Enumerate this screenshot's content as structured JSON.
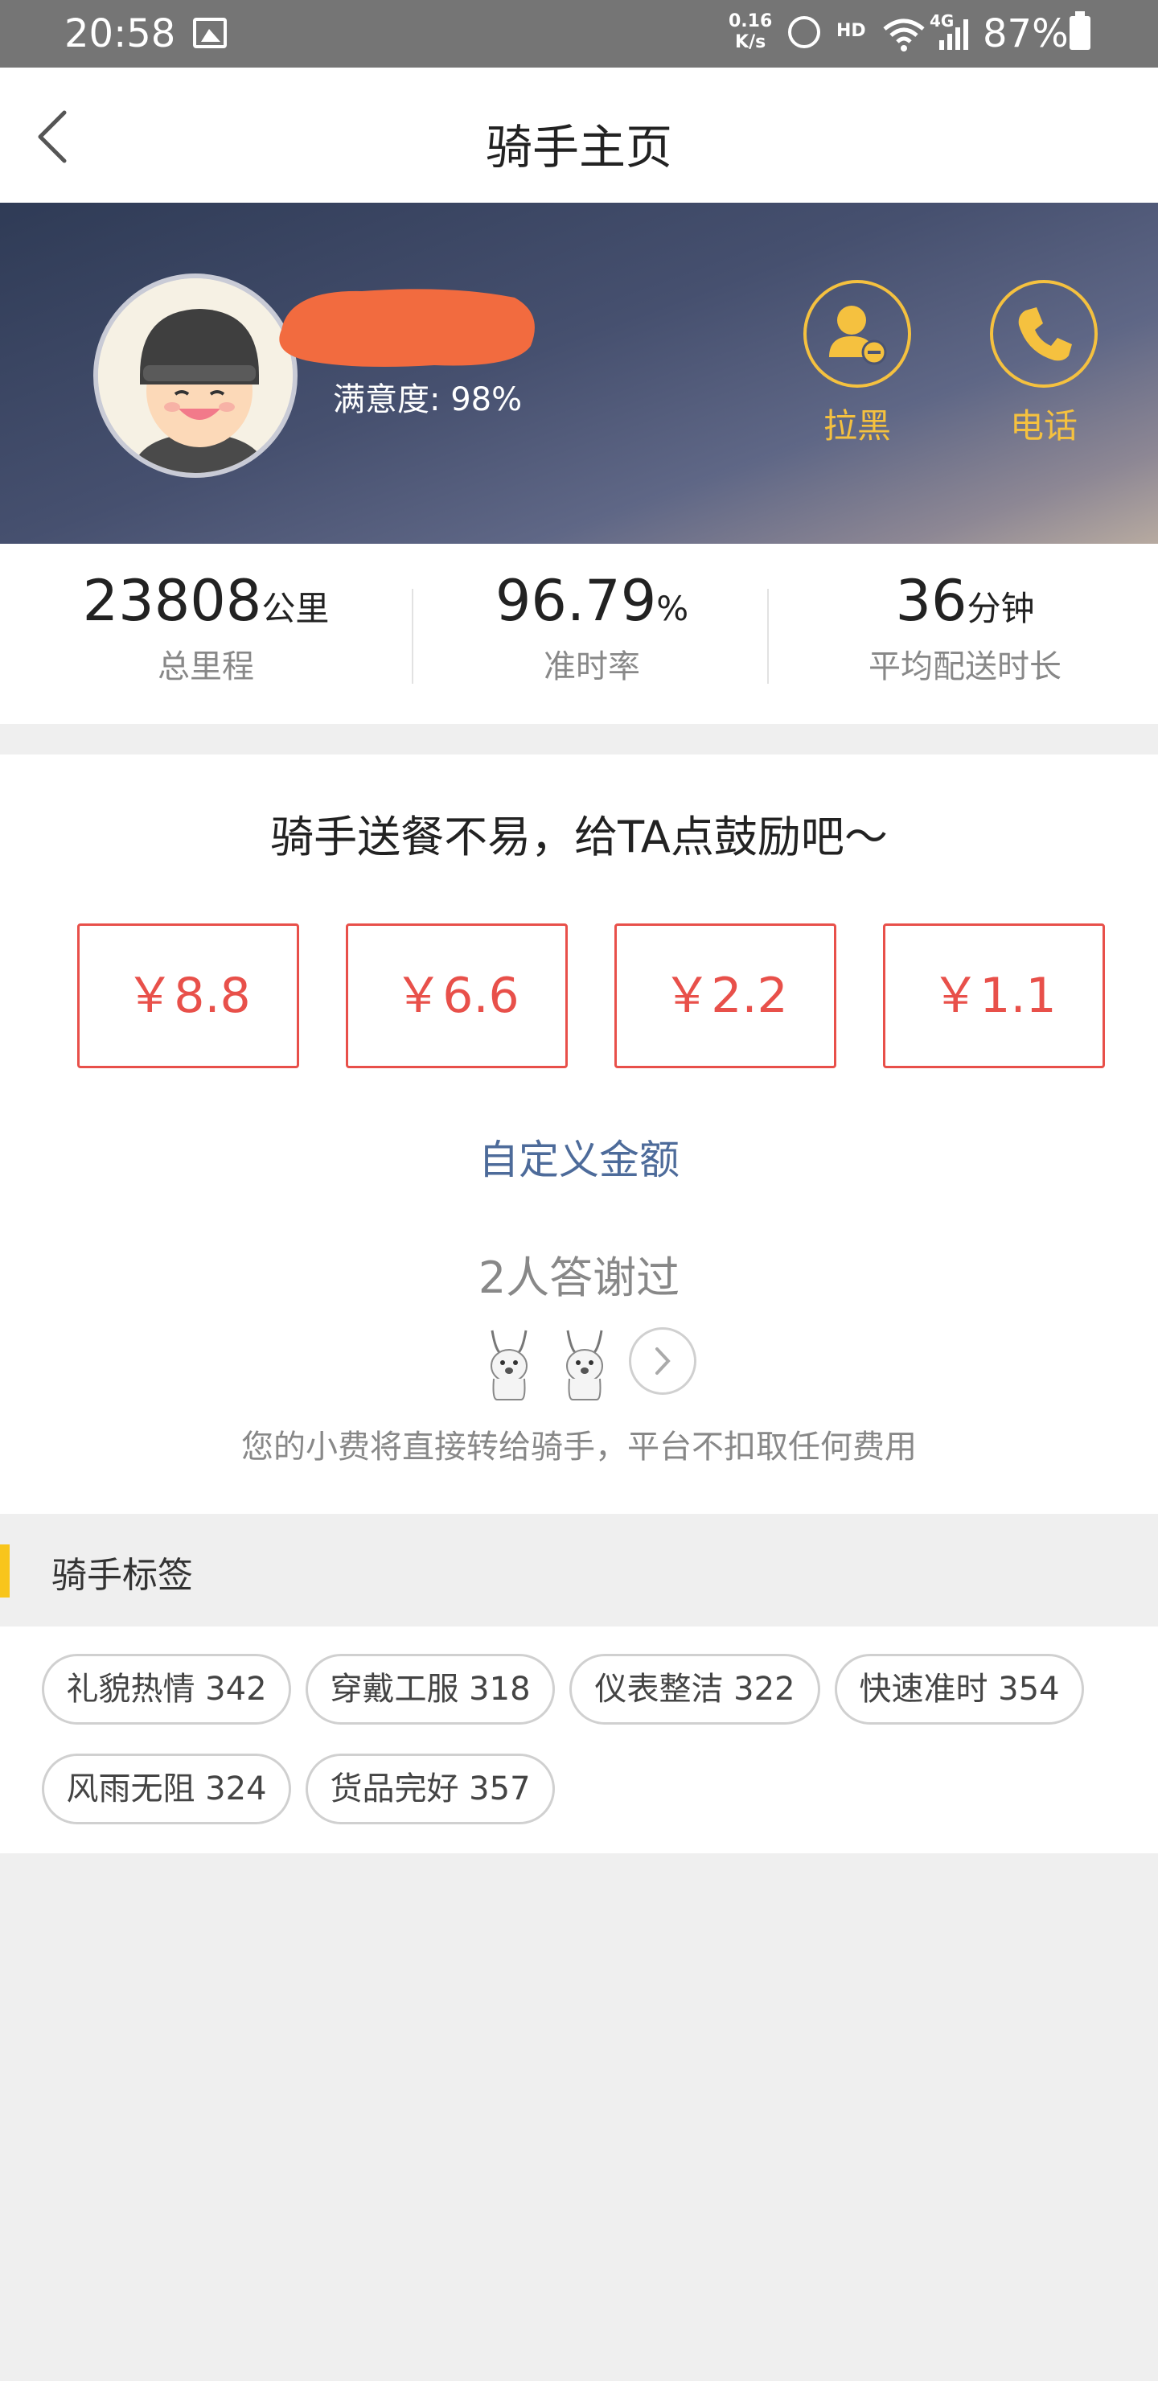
{
  "status_bar": {
    "time": "20:58",
    "speed_top": "0.16",
    "speed_bottom": "K/s",
    "hd": "HD",
    "network": "4G",
    "battery": "87%"
  },
  "nav": {
    "title": "骑手主页"
  },
  "rider": {
    "satisfaction": "满意度: 98%",
    "actions": [
      {
        "label": "拉黑",
        "icon": "person-minus-icon"
      },
      {
        "label": "电话",
        "icon": "phone-icon"
      }
    ]
  },
  "stats": [
    {
      "value": "23808",
      "unit": "公里",
      "label": "总里程"
    },
    {
      "value": "96.79",
      "unit": "%",
      "label": "准时率"
    },
    {
      "value": "36",
      "unit": "分钟",
      "label": "平均配送时长"
    }
  ],
  "tip": {
    "heading": "骑手送餐不易，给TA点鼓励吧～",
    "amounts": [
      "￥8.8",
      "￥6.6",
      "￥2.2",
      "￥1.1"
    ],
    "custom_label": "自定义金额",
    "thanks_text": "2人答谢过",
    "note": "您的小费将直接转给骑手，平台不扣取任何费用"
  },
  "tags_section": {
    "title": "骑手标签",
    "tags": [
      "礼貌热情 342",
      "穿戴工服 318",
      "仪表整洁 322",
      "快速准时 354",
      "风雨无阻 324",
      "货品完好 357"
    ]
  },
  "colors": {
    "accent_yellow": "#f5c13f",
    "tip_red": "#e8504a",
    "link_blue": "#4d6b9a",
    "tag_bar": "#f8c51c"
  }
}
